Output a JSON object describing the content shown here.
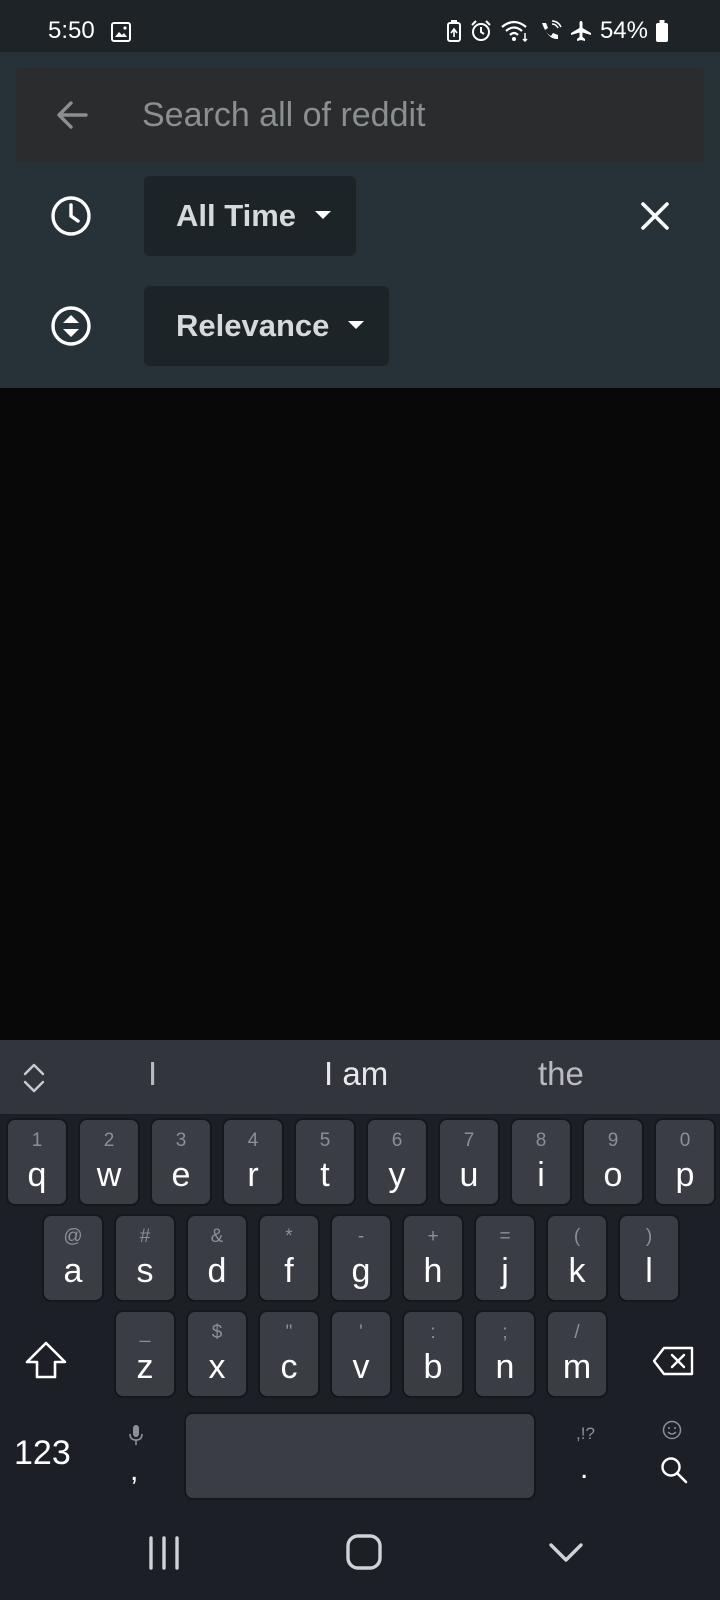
{
  "status_bar": {
    "time": "5:50",
    "battery": "54%",
    "icons": [
      "image-icon",
      "battery-saver-icon",
      "alarm-icon",
      "wifi-icon",
      "wifi-calling-icon",
      "airplane-icon",
      "battery-icon"
    ]
  },
  "search": {
    "placeholder": "Search all of reddit",
    "value": ""
  },
  "filters": {
    "time_label": "All Time",
    "sort_label": "Relevance"
  },
  "keyboard": {
    "suggestions": [
      "I",
      "I am",
      "the"
    ],
    "rows": [
      [
        {
          "hint": "1",
          "key": "q"
        },
        {
          "hint": "2",
          "key": "w"
        },
        {
          "hint": "3",
          "key": "e"
        },
        {
          "hint": "4",
          "key": "r"
        },
        {
          "hint": "5",
          "key": "t"
        },
        {
          "hint": "6",
          "key": "y"
        },
        {
          "hint": "7",
          "key": "u"
        },
        {
          "hint": "8",
          "key": "i"
        },
        {
          "hint": "9",
          "key": "o"
        },
        {
          "hint": "0",
          "key": "p"
        }
      ],
      [
        {
          "hint": "@",
          "key": "a"
        },
        {
          "hint": "#",
          "key": "s"
        },
        {
          "hint": "&",
          "key": "d"
        },
        {
          "hint": "*",
          "key": "f"
        },
        {
          "hint": "-",
          "key": "g"
        },
        {
          "hint": "+",
          "key": "h"
        },
        {
          "hint": "=",
          "key": "j"
        },
        {
          "hint": "(",
          "key": "k"
        },
        {
          "hint": ")",
          "key": "l"
        }
      ],
      [
        {
          "hint": "_",
          "key": "z"
        },
        {
          "hint": "$",
          "key": "x"
        },
        {
          "hint": "\"",
          "key": "c"
        },
        {
          "hint": "'",
          "key": "v"
        },
        {
          "hint": ":",
          "key": "b"
        },
        {
          "hint": ";",
          "key": "n"
        },
        {
          "hint": "/",
          "key": "m"
        }
      ]
    ],
    "num_label": "123",
    "comma": ",",
    "period": ".",
    "period_symbols": ",!?"
  },
  "colors": {
    "header_bg": "#263238",
    "dropdown_bg": "#1d2428",
    "keyboard_bg": "#1c1f26",
    "key_bg": "#3b3d45"
  }
}
